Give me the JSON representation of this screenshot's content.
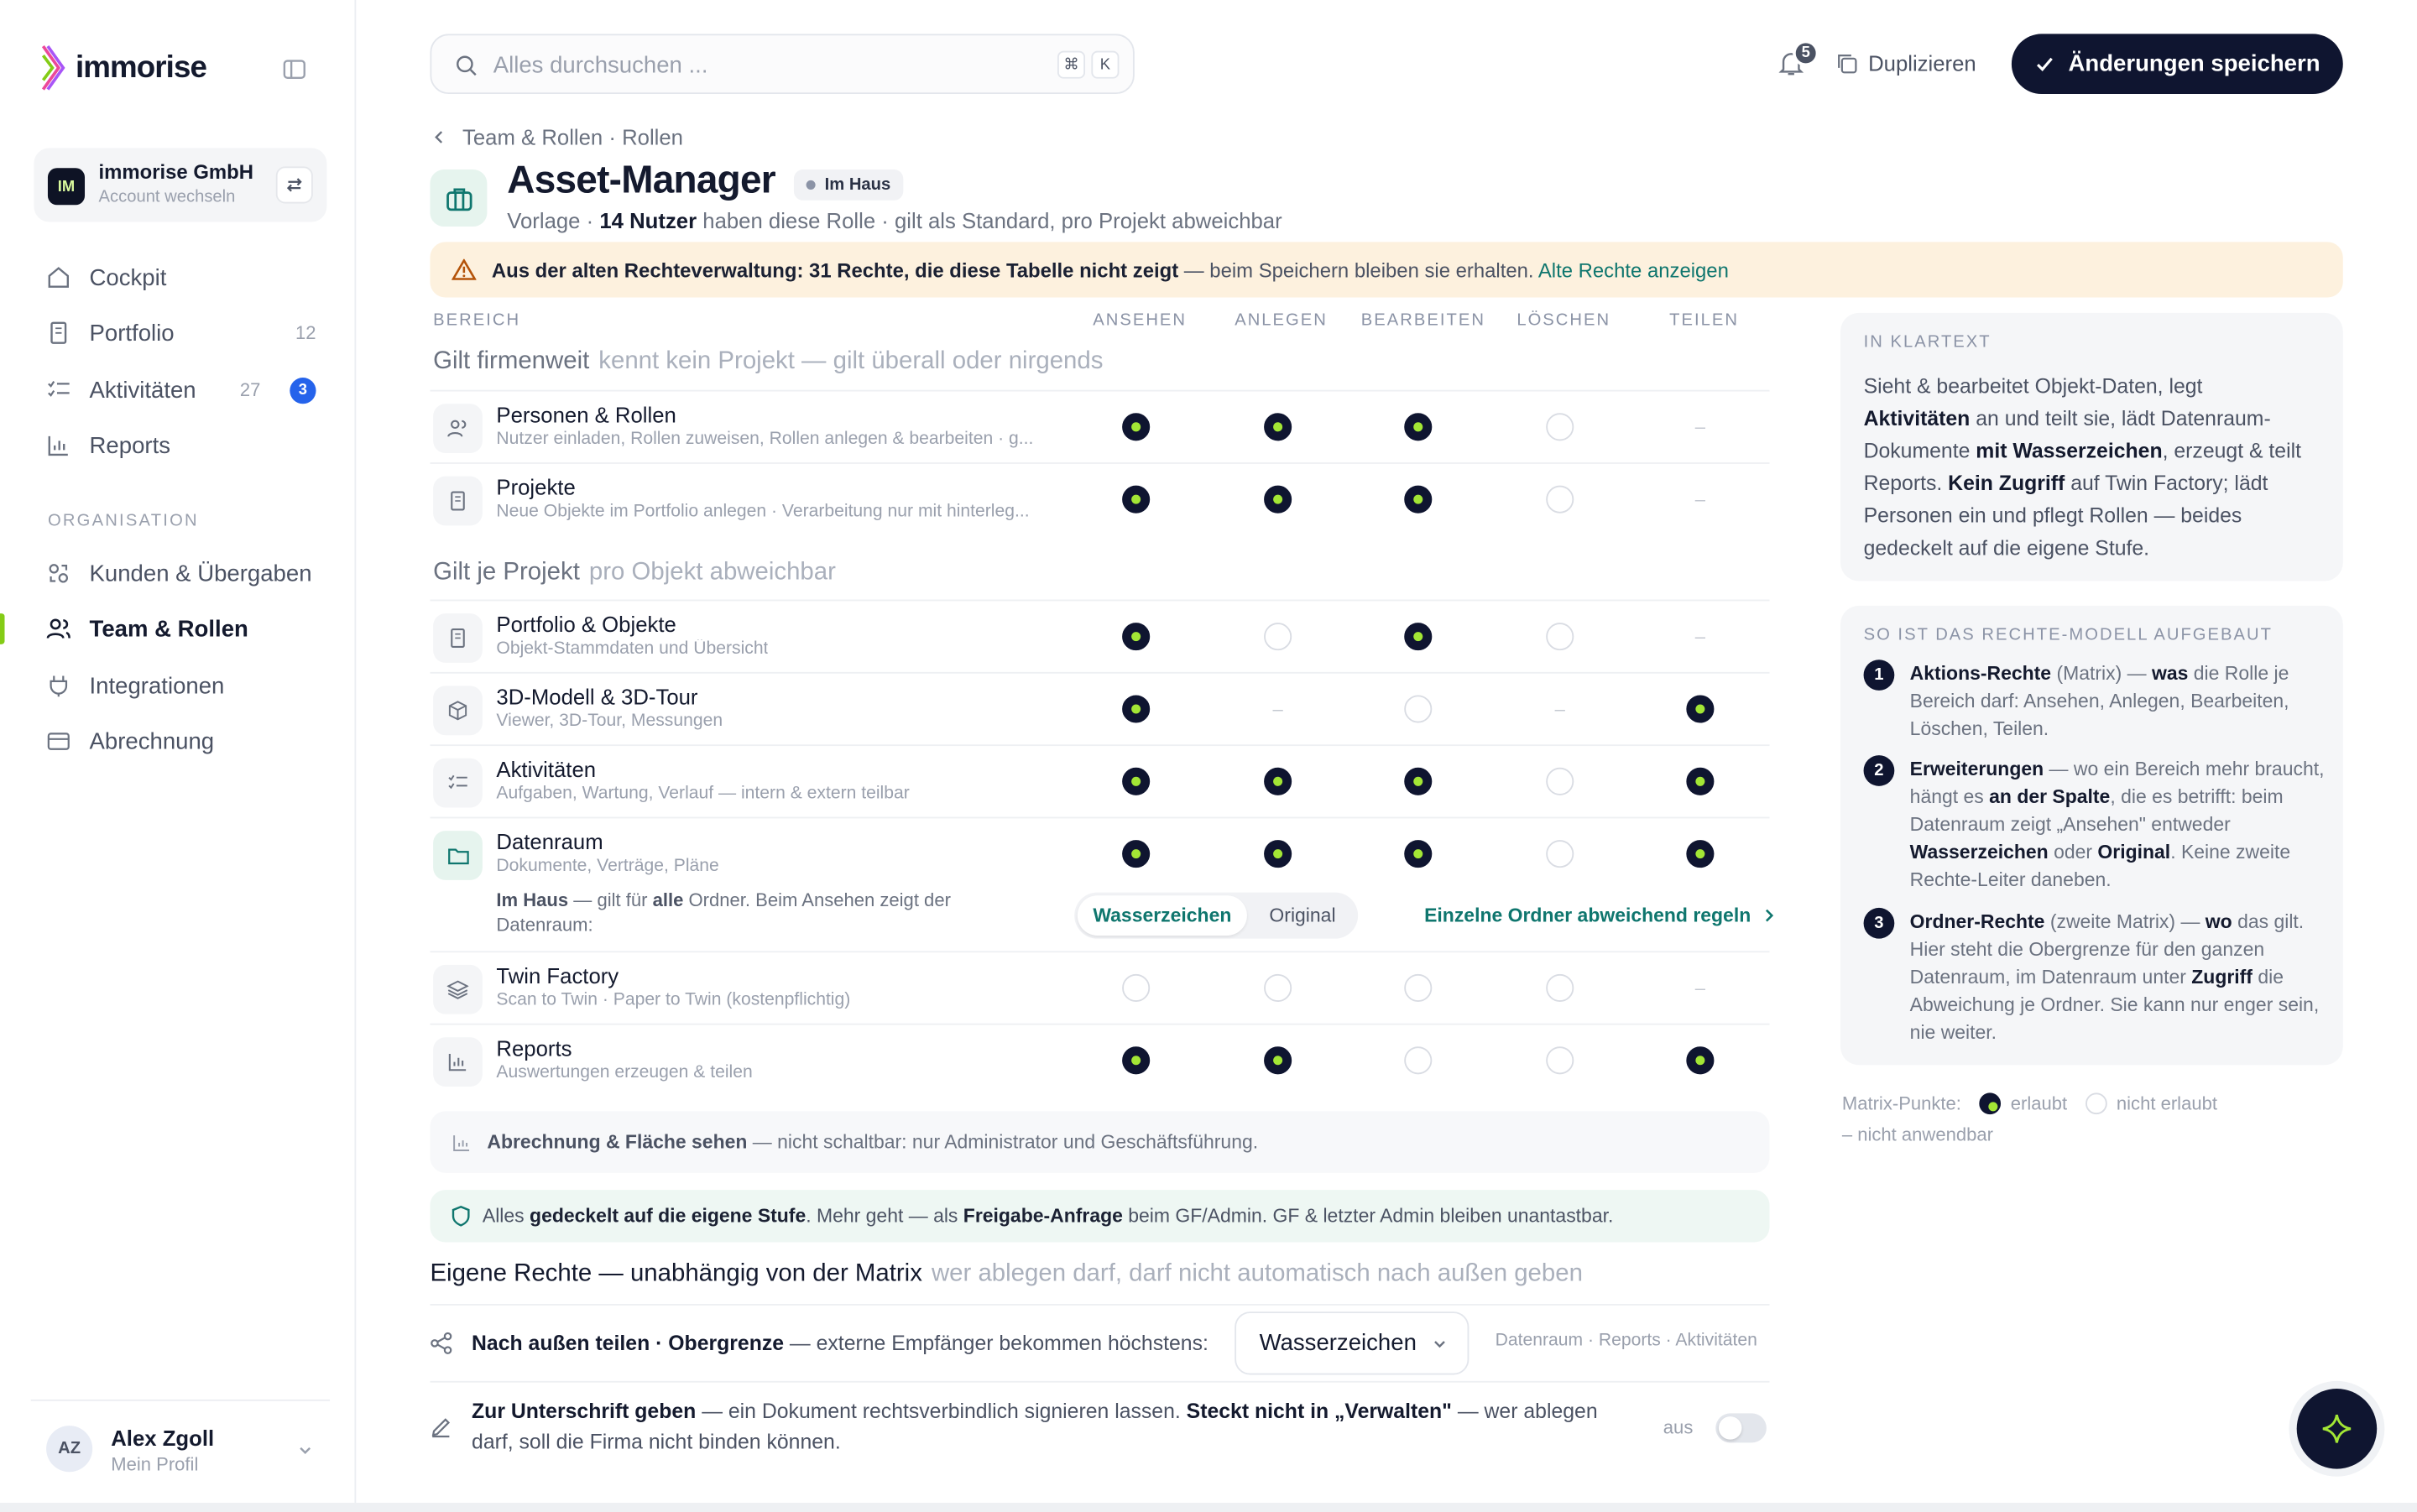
{
  "brand": {
    "name": "immorise"
  },
  "account": {
    "avatar": "IM",
    "name": "immorise GmbH",
    "sub": "Account wechseln"
  },
  "nav": {
    "items": [
      {
        "label": "Cockpit",
        "icon": "home-icon"
      },
      {
        "label": "Portfolio",
        "count": "12",
        "icon": "building-icon"
      },
      {
        "label": "Aktivitäten",
        "count": "27",
        "badge": "3",
        "icon": "tasks-icon"
      },
      {
        "label": "Reports",
        "icon": "chart-icon"
      }
    ],
    "section": "ORGANISATION",
    "org_items": [
      {
        "label": "Kunden & Übergaben",
        "icon": "handover-icon"
      },
      {
        "label": "Team & Rollen",
        "icon": "users-icon",
        "active": true
      },
      {
        "label": "Integrationen",
        "icon": "plug-icon"
      },
      {
        "label": "Abrechnung",
        "icon": "card-icon"
      }
    ]
  },
  "user": {
    "avatar": "AZ",
    "name": "Alex Zgoll",
    "sub": "Mein Profil"
  },
  "search": {
    "placeholder": "Alles durchsuchen ...",
    "kbd1": "⌘",
    "kbd2": "K"
  },
  "topbar": {
    "bell_count": "5",
    "duplicate": "Duplizieren",
    "save": "Änderungen speichern"
  },
  "header": {
    "breadcrumb": "Team & Rollen · Rollen",
    "title": "Asset-Manager",
    "chip": "Im Haus",
    "sub_pre": "Vorlage · ",
    "sub_bold": "14 Nutzer",
    "sub_post": " haben diese Rolle · gilt als Standard, pro Projekt abweichbar"
  },
  "warning": {
    "bold": "Aus der alten Rechteverwaltung: 31 Rechte, die diese Tabelle nicht zeigt",
    "text": " — beim Speichern bleiben sie erhalten. ",
    "link": "Alte Rechte anzeigen"
  },
  "matrix": {
    "columns": [
      "BEREICH",
      "ANSEHEN",
      "ANLEGEN",
      "BEARBEITEN",
      "LÖSCHEN",
      "TEILEN"
    ],
    "group1": {
      "title": "Gilt firmenweit",
      "hint": "kennt kein Projekt — gilt überall oder nirgends"
    },
    "group2": {
      "title": "Gilt je Projekt",
      "hint": "pro Objekt abweichbar"
    },
    "rows": [
      {
        "title": "Personen & Rollen",
        "sub": "Nutzer einladen, Rollen zuweisen, Rollen anlegen & bearbeiten · g...",
        "icon": "users-icon",
        "values": [
          "on",
          "on",
          "on",
          "off",
          "na"
        ]
      },
      {
        "title": "Projekte",
        "sub": "Neue Objekte im Portfolio anlegen · Verarbeitung nur mit hinterleg...",
        "icon": "building-icon",
        "values": [
          "on",
          "on",
          "on",
          "off",
          "na"
        ]
      },
      {
        "title": "Portfolio & Objekte",
        "sub": "Objekt-Stammdaten und Übersicht",
        "icon": "building-icon",
        "values": [
          "on",
          "off",
          "on",
          "off",
          "na"
        ]
      },
      {
        "title": "3D-Modell & 3D-Tour",
        "sub": "Viewer, 3D-Tour, Messungen",
        "icon": "cube-icon",
        "values": [
          "on",
          "na",
          "off",
          "na",
          "on"
        ]
      },
      {
        "title": "Aktivitäten",
        "sub": "Aufgaben, Wartung, Verlauf — intern & extern teilbar",
        "icon": "tasks-icon",
        "values": [
          "on",
          "on",
          "on",
          "off",
          "on"
        ]
      },
      {
        "title": "Datenraum",
        "sub": "Dokumente, Verträge, Pläne",
        "icon": "folder-icon",
        "values": [
          "on",
          "on",
          "on",
          "off",
          "on"
        ]
      },
      {
        "title": "Twin Factory",
        "sub": "Scan to Twin · Paper to Twin (kostenpflichtig)",
        "icon": "layers-icon",
        "values": [
          "off",
          "off",
          "off",
          "off",
          "na"
        ]
      },
      {
        "title": "Reports",
        "sub": "Auswertungen erzeugen & teilen",
        "icon": "chart-icon",
        "values": [
          "on",
          "on",
          "off",
          "off",
          "on"
        ]
      }
    ],
    "datenraum_note_bold1": "Im Haus",
    "datenraum_note_t1": " — gilt für ",
    "datenraum_note_bold2": "alle",
    "datenraum_note_t2": " Ordner. Beim Ansehen zeigt der Datenraum:",
    "seg_a": "Wasserzeichen",
    "seg_b": "Original",
    "folder_link": "Einzelne Ordner abweichend regeln"
  },
  "billing": {
    "bold": "Abrechnung & Fläche sehen",
    "text": " — nicht schaltbar: nur Administrator und Geschäftsführung."
  },
  "covered": {
    "t1": "Alles ",
    "b1": "gedeckelt auf die eigene Stufe",
    "t2": ". Mehr geht — als ",
    "b2": "Freigabe-Anfrage",
    "t3": " beim GF/Admin. GF & letzter Admin bleiben unantastbar."
  },
  "own": {
    "title": "Eigene Rechte — unabhängig von der Matrix",
    "hint": "wer ablegen darf, darf nicht automatisch nach außen geben",
    "row1_bold": "Nach außen teilen · Obergrenze",
    "row1_text": " — externe Empfänger bekommen höchstens:",
    "row1_select": "Wasserzeichen",
    "row1_scope": "Datenraum · Reports · Aktivitäten",
    "row2_bold1": "Zur Unterschrift geben",
    "row2_t1": " — ein Dokument rechtsverbindlich signieren lassen. ",
    "row2_bold2": "Steckt nicht in „Verwalten\"",
    "row2_t2": " — wer ablegen darf, soll die Firma nicht binden können.",
    "toggle_label": "aus"
  },
  "panel1": {
    "title": "IN KLARTEXT",
    "t1": "Sieht & bearbeitet Objekt-Daten, legt ",
    "b1": "Aktivitäten",
    "t2": " an und teilt sie, lädt Datenraum-Dokumente ",
    "b2": "mit Wasserzeichen",
    "t3": ", erzeugt & teilt Reports. ",
    "b3": "Kein Zugriff",
    "t4": " auf Twin Factory; lädt Personen ein und pflegt Rollen — beides gedeckelt auf die eigene Stufe."
  },
  "panel2": {
    "title": "SO IST DAS RECHTE-MODELL AUFGEBAUT",
    "s1_b1": "Aktions-Rechte",
    "s1_t1": " (Matrix) — ",
    "s1_b2": "was",
    "s1_t2": " die Rolle je Bereich darf: Ansehen, Anlegen, Bearbeiten, Löschen, Teilen.",
    "s2_b1": "Erweiterungen",
    "s2_t1": " — wo ein Bereich mehr braucht, hängt es ",
    "s2_b2": "an der Spalte",
    "s2_t2": ", die es betrifft: beim Datenraum zeigt „Ansehen\" entweder ",
    "s2_b3": "Wasserzeichen",
    "s2_t3": " oder ",
    "s2_b4": "Original",
    "s2_t4": ". Keine zweite Rechte-Leiter daneben.",
    "s3_b1": "Ordner-Rechte",
    "s3_t1": " (zweite Matrix) — ",
    "s3_b2": "wo",
    "s3_t2": " das gilt. Hier steht die Obergrenze für den ganzen Datenraum, im Datenraum unter ",
    "s3_b3": "Zugriff",
    "s3_t3": " die Abweichung je Ordner. Sie kann nur enger sein, nie weiter."
  },
  "legend": {
    "label": "Matrix-Punkte:",
    "on": "erlaubt",
    "off": "nicht erlaubt",
    "na": "– nicht anwendbar"
  },
  "colors": {
    "accent": "#0f1530",
    "lime": "#a3e635",
    "teal": "#0f766e",
    "warning_bg": "#fdf1de"
  }
}
